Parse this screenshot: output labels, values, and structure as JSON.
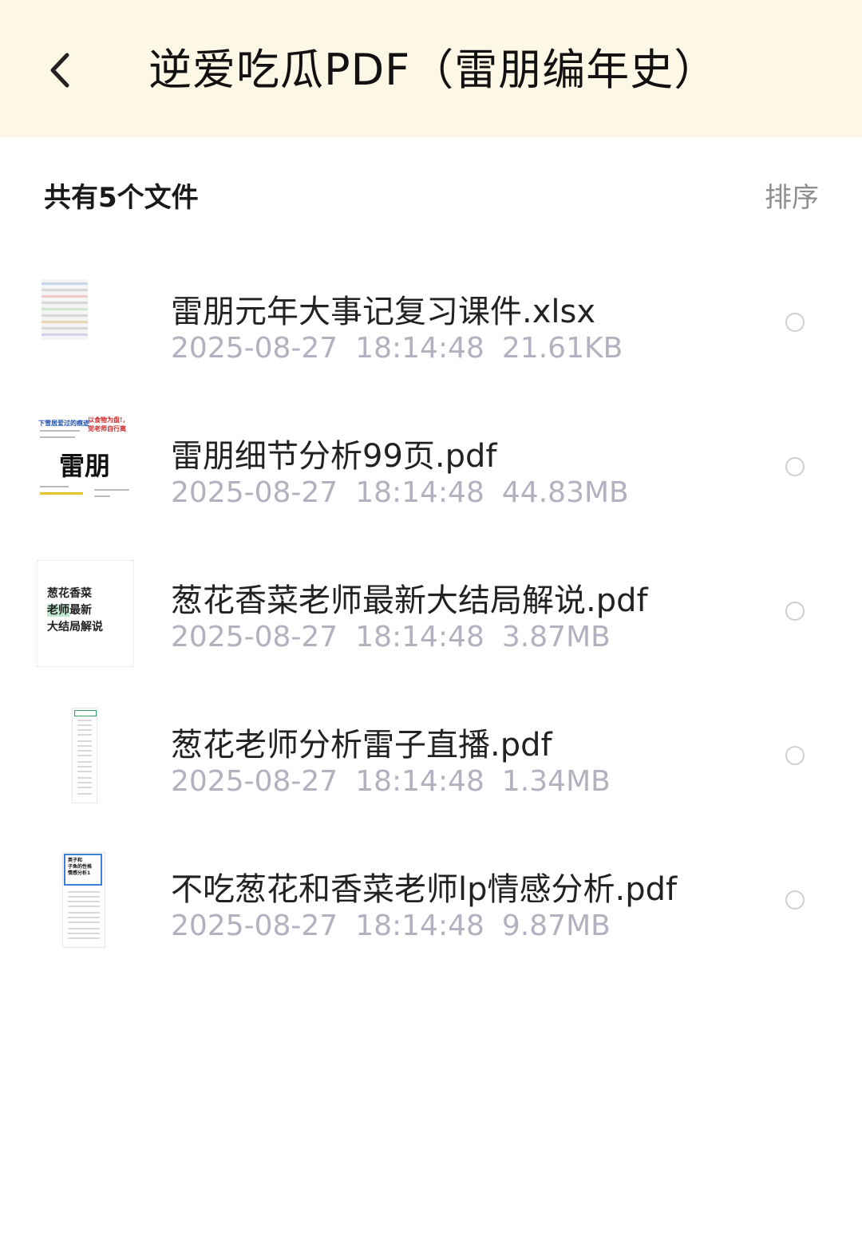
{
  "header": {
    "title": "逆爱吃瓜PDF（雷朋编年史）",
    "back_icon": "chevron-left-icon",
    "background": "#fdf8e6"
  },
  "summary": {
    "count_label": "共有5个文件",
    "sort_label": "排序"
  },
  "files": [
    {
      "name": "雷朋元年大事记复习课件.xlsx",
      "date": "2025-08-27",
      "time": "18:14:48",
      "size": "21.61KB",
      "thumb": "spreadsheet-thumbnail"
    },
    {
      "name": "雷朋细节分析99页.pdf",
      "date": "2025-08-27",
      "time": "18:14:48",
      "size": "44.83MB",
      "thumb": "pdf-cover-thumbnail",
      "thumb_text": {
        "top_left": "下雪居爱过的痕迹",
        "top_right": "以食物为盘!，",
        "top_right2": "觉老师自行离",
        "title": "雷朋"
      }
    },
    {
      "name": "葱花香菜老师最新大结局解说.pdf",
      "date": "2025-08-27",
      "time": "18:14:48",
      "size": "3.87MB",
      "thumb": "pdf-cover-thumbnail",
      "thumb_text": {
        "line1": "葱花香菜",
        "line2a": "老师",
        "line2b": "最新",
        "line3": "大结局解说"
      }
    },
    {
      "name": "葱花老师分析雷子直播.pdf",
      "date": "2025-08-27",
      "time": "18:14:48",
      "size": "1.34MB",
      "thumb": "pdf-page-thumbnail"
    },
    {
      "name": "不吃葱花和香菜老师lp情感分析.pdf",
      "date": "2025-08-27",
      "time": "18:14:48",
      "size": "9.87MB",
      "thumb": "pdf-page-thumbnail",
      "thumb_text": {
        "line1": "荚子和",
        "line2": "子鱼的性格",
        "line3": "情感分析1"
      }
    }
  ]
}
